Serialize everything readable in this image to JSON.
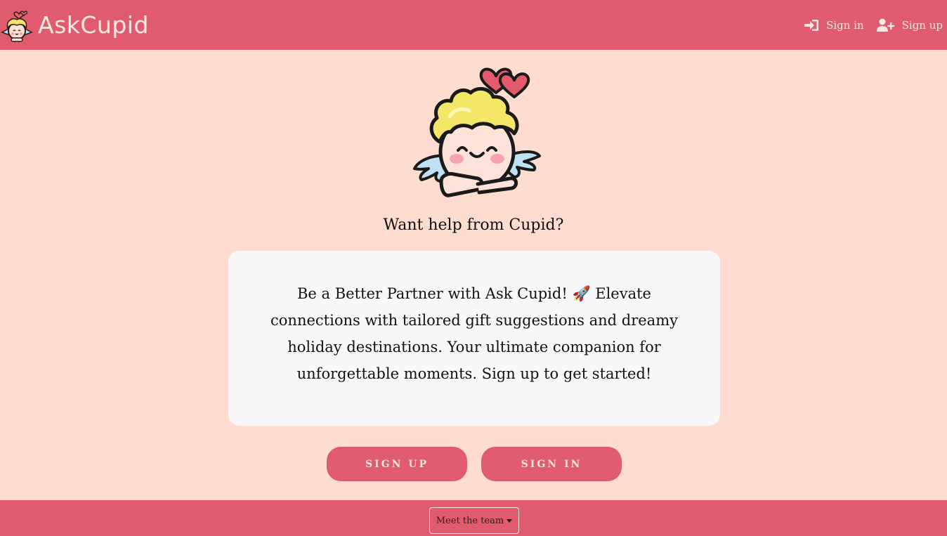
{
  "navbar": {
    "brand": "AskCupid",
    "links": [
      {
        "label": "Sign in",
        "icon": "sign-in-icon"
      },
      {
        "label": "Sign up",
        "icon": "user-plus-icon"
      }
    ]
  },
  "hero": {
    "image": "cupid-icon",
    "question": "Want help from Cupid?"
  },
  "card": {
    "text": "Be a Better Partner with Ask Cupid! 🚀 Elevate connections with tailored gift suggestions and dreamy holiday destinations. Your ultimate companion for unforgettable moments. Sign up to get started!"
  },
  "buttons": {
    "sign_up": "SIGN UP",
    "sign_in": "SIGN IN"
  },
  "footer": {
    "dropdown_label": "Meet the team"
  },
  "colors": {
    "primary": "#DF5B6D",
    "background": "#FEDDD0",
    "card": "#F7F8FA",
    "light_text": "#FCE9E4"
  }
}
